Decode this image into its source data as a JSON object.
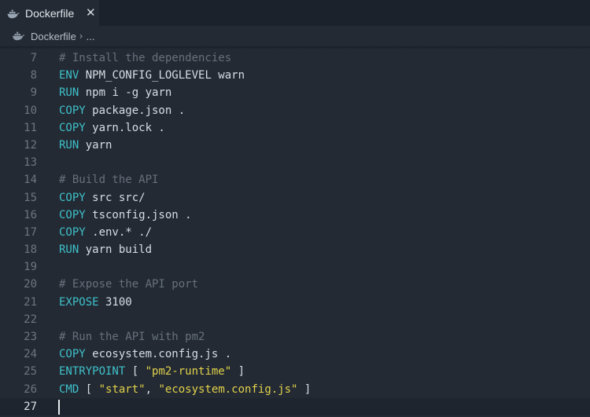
{
  "tab": {
    "label": "Dockerfile",
    "close_glyph": "✕",
    "icon": "docker-whale-icon"
  },
  "breadcrumb": {
    "file": "Dockerfile",
    "separator": "›",
    "more": "..."
  },
  "editor": {
    "current_line": 27,
    "lines": [
      {
        "n": "7",
        "tokens": [
          {
            "t": "# Install the dependencies",
            "k": "comment"
          }
        ]
      },
      {
        "n": "8",
        "tokens": [
          {
            "t": "ENV",
            "k": "keyword"
          },
          {
            "t": " NPM_CONFIG_LOGLEVEL warn",
            "k": "text"
          }
        ]
      },
      {
        "n": "9",
        "tokens": [
          {
            "t": "RUN",
            "k": "keyword"
          },
          {
            "t": " npm i -g yarn",
            "k": "text"
          }
        ]
      },
      {
        "n": "10",
        "tokens": [
          {
            "t": "COPY",
            "k": "keyword"
          },
          {
            "t": " package.json .",
            "k": "text"
          }
        ]
      },
      {
        "n": "11",
        "tokens": [
          {
            "t": "COPY",
            "k": "keyword"
          },
          {
            "t": " yarn.lock .",
            "k": "text"
          }
        ]
      },
      {
        "n": "12",
        "tokens": [
          {
            "t": "RUN",
            "k": "keyword"
          },
          {
            "t": " yarn",
            "k": "text"
          }
        ]
      },
      {
        "n": "13",
        "tokens": []
      },
      {
        "n": "14",
        "tokens": [
          {
            "t": "# Build the API",
            "k": "comment"
          }
        ]
      },
      {
        "n": "15",
        "tokens": [
          {
            "t": "COPY",
            "k": "keyword"
          },
          {
            "t": " src src/",
            "k": "text"
          }
        ]
      },
      {
        "n": "16",
        "tokens": [
          {
            "t": "COPY",
            "k": "keyword"
          },
          {
            "t": " tsconfig.json .",
            "k": "text"
          }
        ]
      },
      {
        "n": "17",
        "tokens": [
          {
            "t": "COPY",
            "k": "keyword"
          },
          {
            "t": " .env.* ./",
            "k": "text"
          }
        ]
      },
      {
        "n": "18",
        "tokens": [
          {
            "t": "RUN",
            "k": "keyword"
          },
          {
            "t": " yarn build",
            "k": "text"
          }
        ]
      },
      {
        "n": "19",
        "tokens": []
      },
      {
        "n": "20",
        "tokens": [
          {
            "t": "# Expose the API port",
            "k": "comment"
          }
        ]
      },
      {
        "n": "21",
        "tokens": [
          {
            "t": "EXPOSE",
            "k": "keyword"
          },
          {
            "t": " 3100",
            "k": "text"
          }
        ]
      },
      {
        "n": "22",
        "tokens": []
      },
      {
        "n": "23",
        "tokens": [
          {
            "t": "# Run the API with pm2",
            "k": "comment"
          }
        ]
      },
      {
        "n": "24",
        "tokens": [
          {
            "t": "COPY",
            "k": "keyword"
          },
          {
            "t": " ecosystem.config.js .",
            "k": "text"
          }
        ]
      },
      {
        "n": "25",
        "tokens": [
          {
            "t": "ENTRYPOINT",
            "k": "keyword"
          },
          {
            "t": " [ ",
            "k": "text"
          },
          {
            "t": "\"pm2-runtime\"",
            "k": "string"
          },
          {
            "t": " ]",
            "k": "text"
          }
        ]
      },
      {
        "n": "26",
        "tokens": [
          {
            "t": "CMD",
            "k": "keyword"
          },
          {
            "t": " [ ",
            "k": "text"
          },
          {
            "t": "\"start\"",
            "k": "string"
          },
          {
            "t": ", ",
            "k": "text"
          },
          {
            "t": "\"ecosystem.config.js\"",
            "k": "string"
          },
          {
            "t": " ]",
            "k": "text"
          }
        ]
      },
      {
        "n": "27",
        "tokens": []
      }
    ]
  },
  "colors": {
    "background": "#232a34",
    "keyword": "#3fc1c9",
    "string": "#e2d24a",
    "comment": "#67707c",
    "text": "#d8dde3"
  }
}
